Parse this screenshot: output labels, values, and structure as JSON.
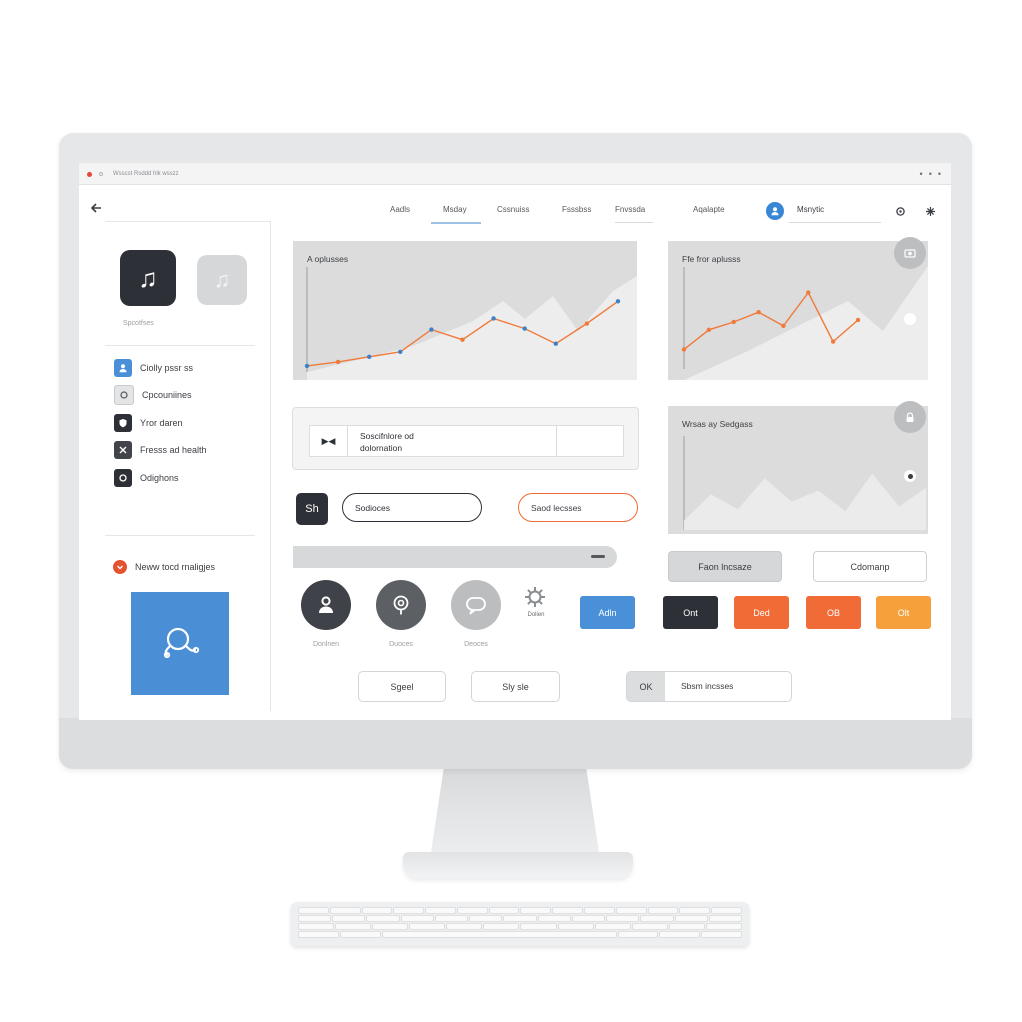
{
  "window": {
    "title": "Wsscst  Rsddd hlk  wsszz",
    "controls": [
      "•",
      "•",
      "•"
    ]
  },
  "nav": {
    "back_icon": "back-arrow-icon",
    "tabs": [
      "Aadls",
      "Msday",
      "Cssnuiss",
      "Fsssbss",
      "Fnvssda",
      "Aqalapte"
    ],
    "active_tab": "Msday",
    "profile_label": "Msnytic",
    "icons": [
      "settings-icon",
      "more-icon"
    ]
  },
  "sidebar": {
    "app_tiles": [
      "music-icon",
      "music-icon"
    ],
    "app_caption": "Spcotfses",
    "items": [
      {
        "label": "Ciolly pssr ss",
        "icon": "user-icon",
        "color": "#4a90d9"
      },
      {
        "label": "Cpcouniines",
        "icon": "circle-icon",
        "color": "#c9cacc"
      },
      {
        "label": "Yror daren",
        "icon": "shield-icon",
        "color": "#2d3036"
      },
      {
        "label": "Fresss ad health",
        "icon": "tools-icon",
        "color": "#41444a"
      },
      {
        "label": "Odighons",
        "icon": "circle-icon",
        "color": "#2d3036"
      }
    ],
    "alert_label": "Neww tocd rnaligjes",
    "alert_icon": "chevron-down-icon",
    "promo_icon": "link-icon"
  },
  "cards": {
    "chart1_title": "A oplusses",
    "chart2_title": "Ffe fror aplusss",
    "chart3_title": "Wrsas ay Sedgass",
    "description_card": {
      "icon": "play-pause-icon",
      "text_line1": "Soscifnlore od",
      "text_line2": "dolornation"
    },
    "chart2_badges": [
      "camera-icon",
      "dot-icon"
    ],
    "chart3_badges": [
      "lock-icon",
      "dot-icon"
    ]
  },
  "controls": {
    "sh_label": "Sh",
    "pill_left": "Sodioces",
    "pill_right": "Saod lecsses",
    "slider_icon": "minus-icon",
    "form_button": "Faon lncsaze",
    "outline_button": "Cdomanp",
    "circle_icons": [
      {
        "name": "user-circle-icon",
        "label": "Donlnen"
      },
      {
        "name": "location-circle-icon",
        "label": "Duoces"
      },
      {
        "name": "chat-circle-icon",
        "label": "Deoces"
      }
    ],
    "gear_label": "Dolien",
    "color_buttons": [
      {
        "label": "Adln",
        "color": "#4a90d9"
      },
      {
        "label": "Ont",
        "color": "#2d3036"
      },
      {
        "label": "Ded",
        "color": "#f06b35"
      },
      {
        "label": "OB",
        "color": "#f06b35"
      },
      {
        "label": "Olt",
        "color": "#f6a03c"
      }
    ],
    "bottom_buttons": [
      "Sgeel",
      "Sly sle"
    ],
    "ok_label": "OK",
    "ok_field": "Sbsm incsses"
  },
  "chart_data": [
    {
      "type": "line",
      "title": "A oplusses",
      "x": [
        1,
        2,
        3,
        4,
        5,
        6,
        7,
        8,
        9,
        10,
        11
      ],
      "series": [
        {
          "values": [
            6,
            10,
            15,
            20,
            42,
            32,
            53,
            43,
            28,
            48,
            70
          ]
        }
      ],
      "ylim": [
        0,
        100
      ],
      "grid": false
    },
    {
      "type": "line",
      "title": "Ffe fror aplusss",
      "x": [
        1,
        2,
        3,
        4,
        5,
        6,
        7,
        8
      ],
      "series": [
        {
          "values": [
            20,
            40,
            48,
            58,
            44,
            78,
            28,
            50
          ]
        }
      ],
      "ylim": [
        0,
        100
      ],
      "grid": false
    },
    {
      "type": "area",
      "title": "Wrsas ay Sedgass",
      "x": [
        1,
        2,
        3,
        4,
        5,
        6,
        7,
        8,
        9,
        10
      ],
      "series": [
        {
          "values": [
            10,
            38,
            22,
            55,
            30,
            42,
            20,
            60,
            25,
            45
          ]
        }
      ],
      "ylim": [
        0,
        100
      ],
      "grid": false
    }
  ]
}
